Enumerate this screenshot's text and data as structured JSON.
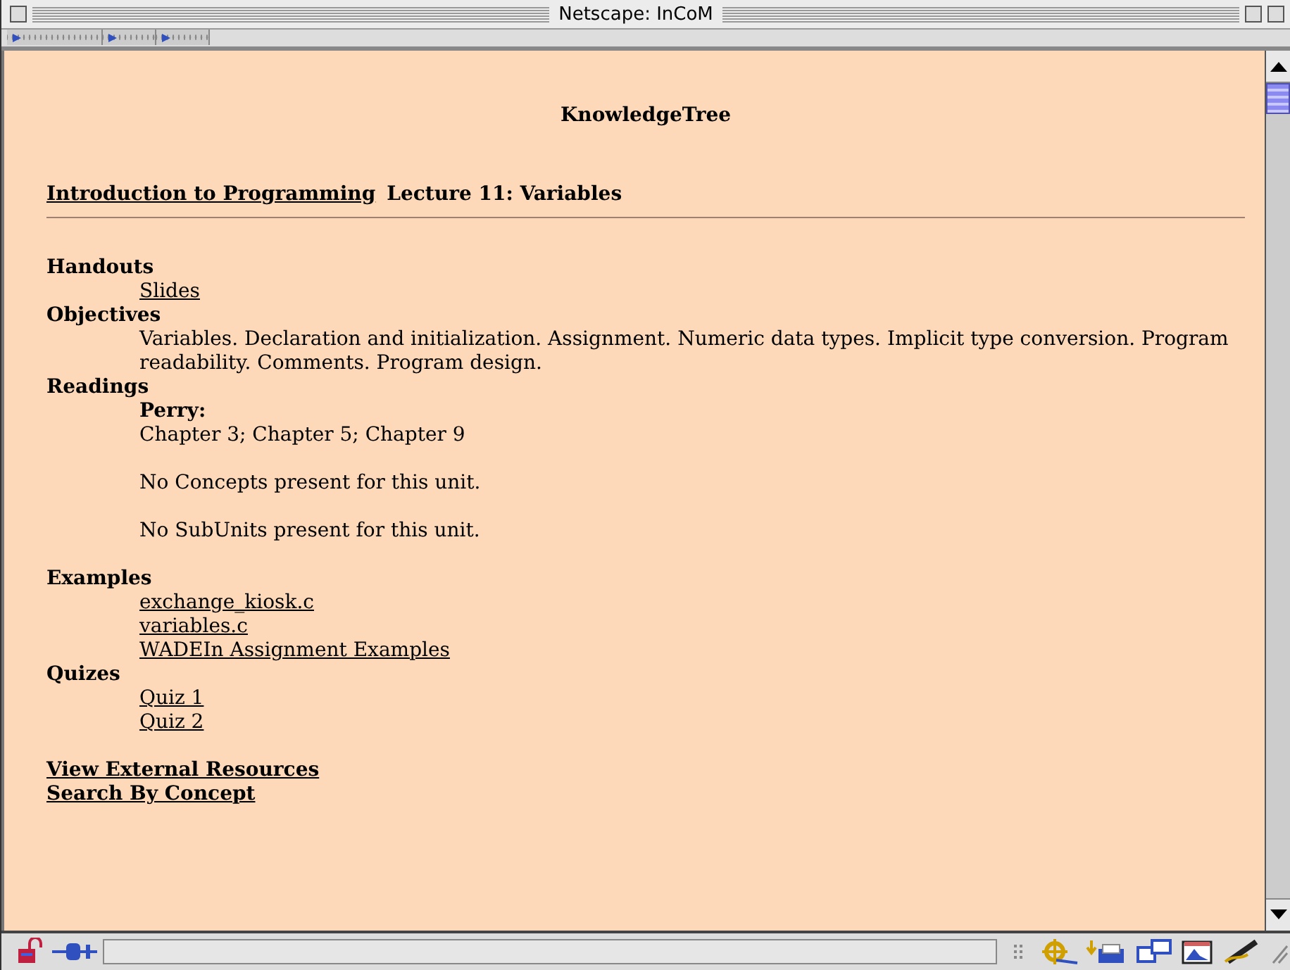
{
  "window": {
    "title": "Netscape: InCoM"
  },
  "page": {
    "site_title": "KnowledgeTree",
    "course_link": "Introduction to Programming",
    "lecture_title": "Lecture 11: Variables",
    "sections": [
      {
        "heading": "Handouts",
        "items": [
          {
            "kind": "link",
            "text": "Slides"
          }
        ]
      },
      {
        "heading": "Objectives",
        "items": [
          {
            "kind": "text",
            "text": "Variables. Declaration and initialization. Assignment. Numeric data types. Implicit type conversion. Program readability. Comments. Program design."
          }
        ]
      },
      {
        "heading": "Readings",
        "items": [
          {
            "kind": "bold",
            "text": "Perry:"
          },
          {
            "kind": "text",
            "text": "Chapter 3; Chapter 5; Chapter 9"
          },
          {
            "kind": "note",
            "text": "No Concepts present for this unit."
          },
          {
            "kind": "note",
            "text": "No SubUnits present for this unit."
          }
        ]
      },
      {
        "heading": "Examples",
        "items": [
          {
            "kind": "link",
            "text": "exchange_kiosk.c"
          },
          {
            "kind": "link",
            "text": "variables.c"
          },
          {
            "kind": "link",
            "text": "WADEIn Assignment Examples"
          }
        ]
      },
      {
        "heading": "Quizes",
        "items": [
          {
            "kind": "link",
            "text": "Quiz 1"
          },
          {
            "kind": "link",
            "text": "Quiz 2"
          }
        ]
      }
    ],
    "footer_links": [
      "View External Resources",
      "Search By Concept"
    ]
  }
}
